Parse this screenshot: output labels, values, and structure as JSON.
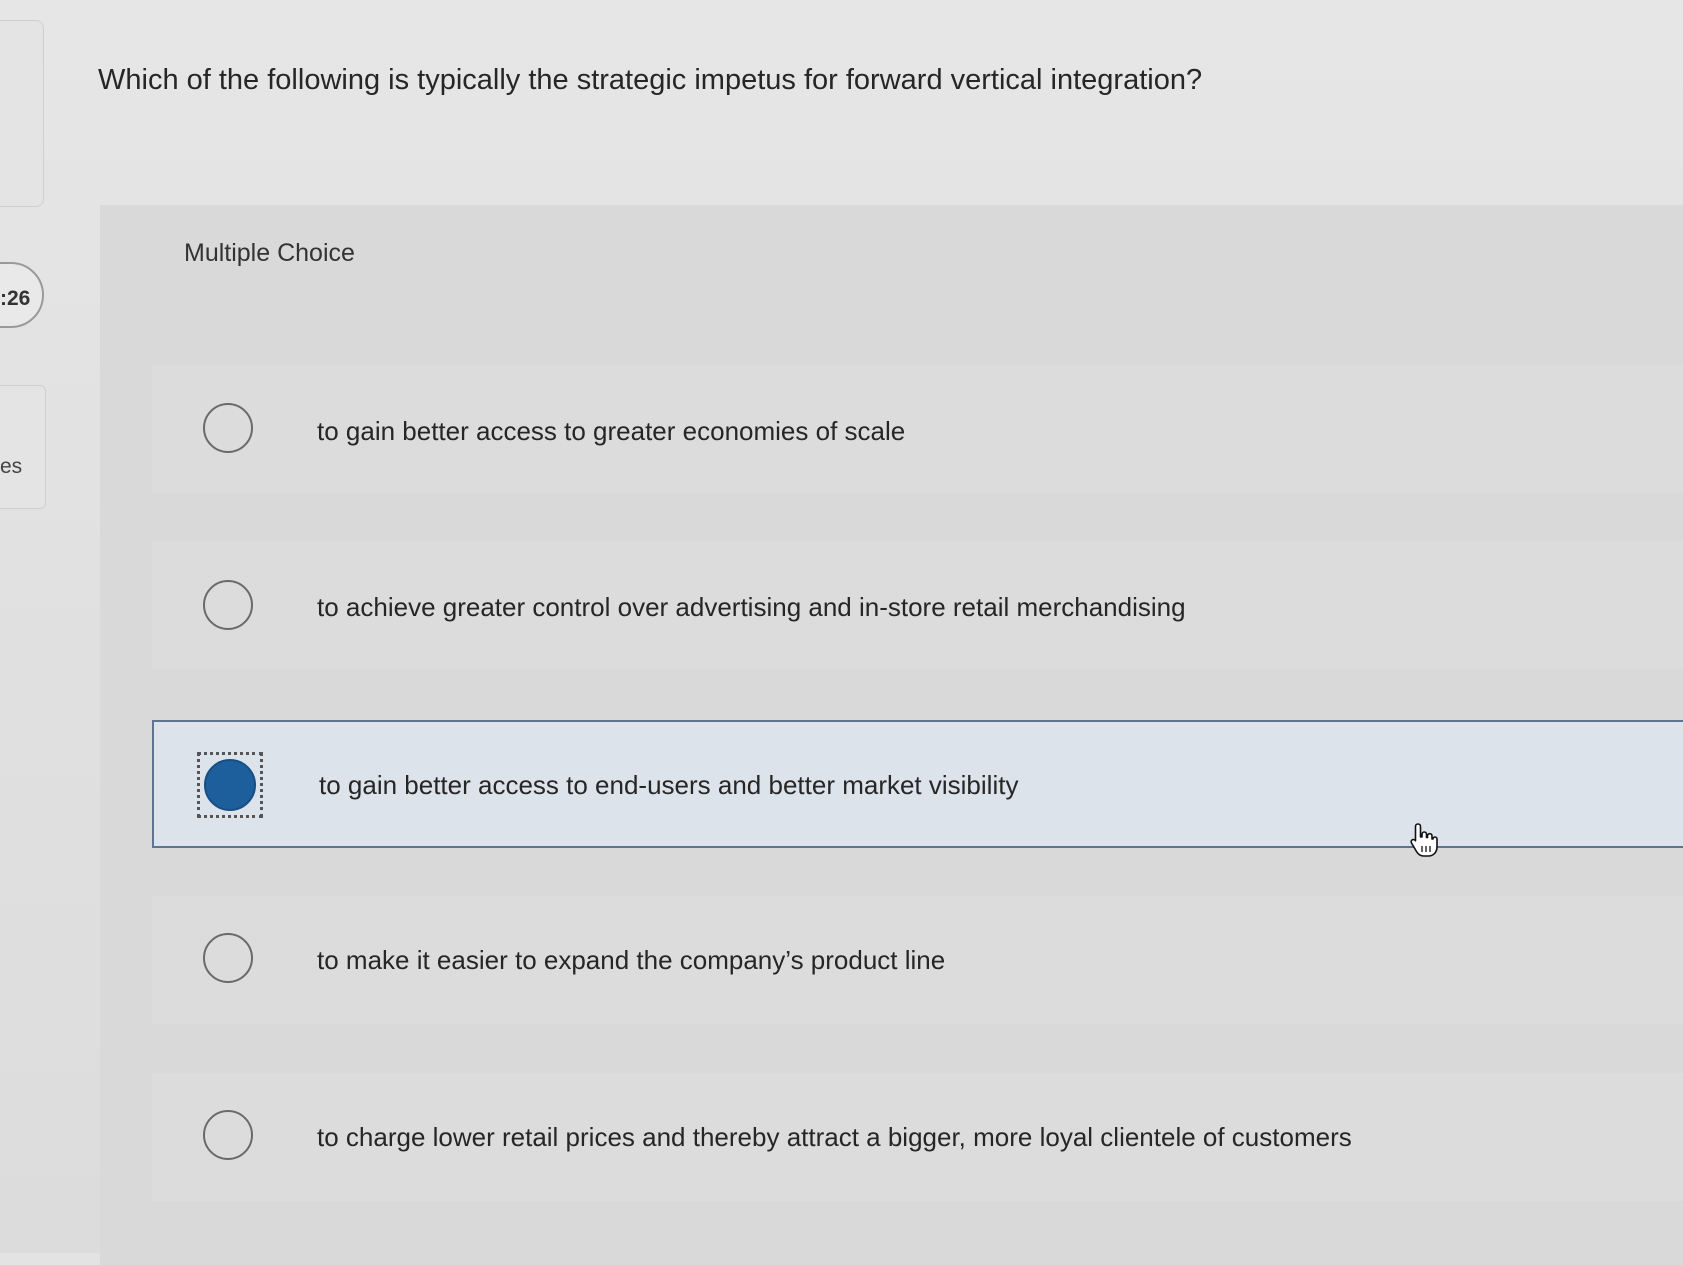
{
  "sidebar": {
    "timer_text": ":26",
    "partial_label": "es"
  },
  "question": {
    "text": "Which of the following is typically the strategic impetus for forward vertical integration?"
  },
  "quiz": {
    "type_label": "Multiple Choice",
    "options": [
      {
        "label": "to gain better access to greater economies of scale",
        "selected": false
      },
      {
        "label": "to achieve greater control over advertising and in-store retail merchandising",
        "selected": false
      },
      {
        "label": "to gain better access to end-users and better market visibility",
        "selected": true
      },
      {
        "label": "to make it easier to expand the company’s product line",
        "selected": false
      },
      {
        "label": "to charge lower retail prices and thereby attract a bigger, more loyal clientele of customers",
        "selected": false
      }
    ]
  },
  "colors": {
    "selected_fill": "#1d5f9c",
    "selected_border": "#5d7591",
    "selected_background": "#dde3ea"
  },
  "icons": {
    "cursor": "hand-pointer-icon",
    "radio": "radio-button-icon"
  }
}
